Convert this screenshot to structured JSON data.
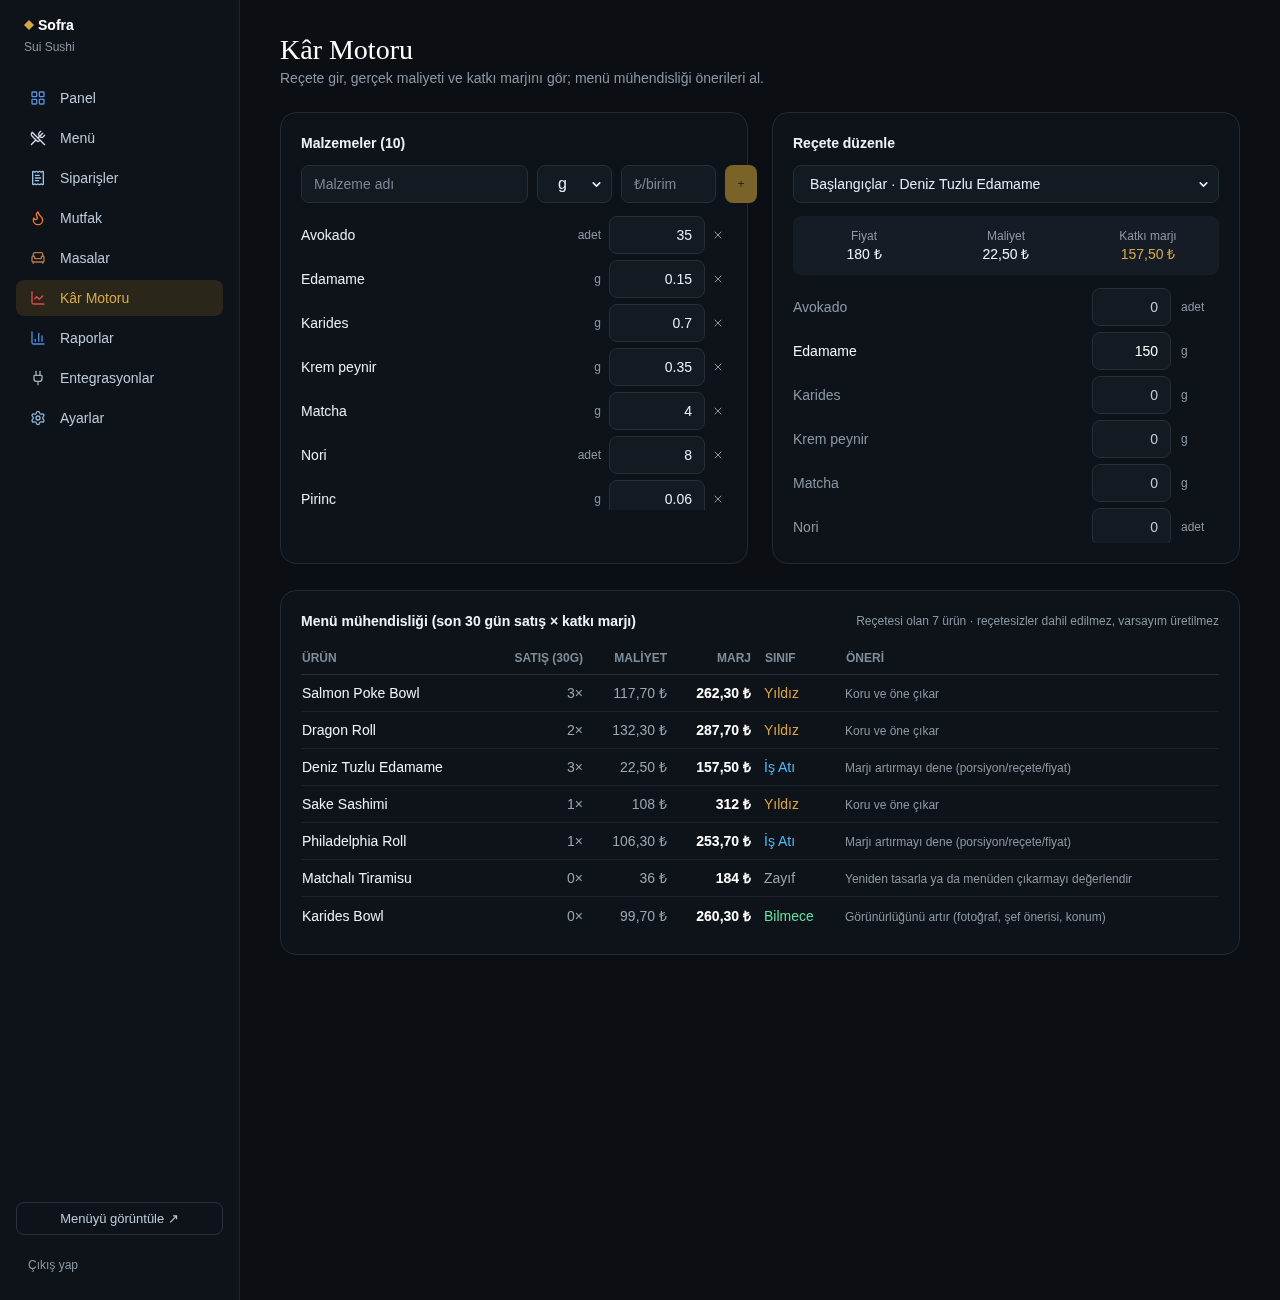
{
  "sidebar": {
    "brand": "Sofra",
    "subtitle": "Sui Sushi",
    "items": [
      {
        "label": "Panel",
        "selected": false
      },
      {
        "label": "Menü",
        "selected": false
      },
      {
        "label": "Siparişler",
        "selected": false
      },
      {
        "label": "Mutfak",
        "selected": false
      },
      {
        "label": "Masalar",
        "selected": false
      },
      {
        "label": "Kâr Motoru",
        "selected": true
      },
      {
        "label": "Raporlar",
        "selected": false
      },
      {
        "label": "Entegrasyonlar",
        "selected": false
      },
      {
        "label": "Ayarlar",
        "selected": false
      }
    ],
    "view_menu_button": "Menüyü görüntüle ↗",
    "logout_link": "Çıkış yap"
  },
  "page": {
    "title": "Kâr Motoru",
    "subtitle": "Reçete gir, gerçek maliyeti ve katkı marjını gör; menü mühendisliği önerileri al."
  },
  "ingredients": {
    "title": "Malzemeler (10)",
    "name_field": {
      "placeholder": "Malzeme adı"
    },
    "unit_select": {
      "value": "g"
    },
    "price_field": {
      "placeholder": "₺/birim"
    },
    "add_button": "+",
    "rows": [
      {
        "name": "Avokado",
        "unit": "adet",
        "price": "35"
      },
      {
        "name": "Edamame",
        "unit": "g",
        "price": "0.15"
      },
      {
        "name": "Karides",
        "unit": "g",
        "price": "0.7"
      },
      {
        "name": "Krem peynir",
        "unit": "g",
        "price": "0.35"
      },
      {
        "name": "Matcha",
        "unit": "g",
        "price": "4"
      },
      {
        "name": "Nori",
        "unit": "adet",
        "price": "8"
      },
      {
        "name": "Pirinc",
        "unit": "g",
        "price": "0.06"
      }
    ]
  },
  "recipe": {
    "title": "Reçete düzenle",
    "item_select": {
      "value": "Başlangıçlar · Deniz Tuzlu Edamame"
    },
    "summary": [
      {
        "label": "Fiyat",
        "value": "180 ₺",
        "highlighted": false
      },
      {
        "label": "Maliyet",
        "value": "22,50 ₺",
        "highlighted": false
      },
      {
        "label": "Katkı marjı",
        "value": "157,50 ₺",
        "highlighted": true
      }
    ],
    "rows": [
      {
        "name": "Avokado",
        "amount": "0",
        "unit": "adet",
        "included": false
      },
      {
        "name": "Edamame",
        "amount": "150",
        "unit": "g",
        "included": true
      },
      {
        "name": "Karides",
        "amount": "0",
        "unit": "g",
        "included": false
      },
      {
        "name": "Krem peynir",
        "amount": "0",
        "unit": "g",
        "included": false
      },
      {
        "name": "Matcha",
        "amount": "0",
        "unit": "g",
        "included": false
      },
      {
        "name": "Nori",
        "amount": "0",
        "unit": "adet",
        "included": false
      }
    ]
  },
  "menu_engineering": {
    "title": "Menü mühendisliği (son 30 gün satış × katkı marjı)",
    "note": "Reçetesi olan 7 ürün · reçetesizler dahil edilmez, varsayım üretilmez",
    "columns": [
      "ÜRÜN",
      "SATIŞ (30G)",
      "MALİYET",
      "MARJ",
      "SINIF",
      "ÖNERİ"
    ],
    "rows": [
      {
        "product": "Salmon Poke Bowl",
        "sales": "3×",
        "cost": "117,70 ₺",
        "margin": "262,30 ₺",
        "class": "Yıldız",
        "color": "#d9a441",
        "suggestion": "Koru ve öne çıkar"
      },
      {
        "product": "Dragon Roll",
        "sales": "2×",
        "cost": "132,30 ₺",
        "margin": "287,70 ₺",
        "class": "Yıldız",
        "color": "#d9a441",
        "suggestion": "Koru ve öne çıkar"
      },
      {
        "product": "Deniz Tuzlu Edamame",
        "sales": "3×",
        "cost": "22,50 ₺",
        "margin": "157,50 ₺",
        "class": "İş Atı",
        "color": "#4db8f5",
        "suggestion": "Marjı artırmayı dene (porsiyon/reçete/fiyat)"
      },
      {
        "product": "Sake Sashimi",
        "sales": "1×",
        "cost": "108 ₺",
        "margin": "312 ₺",
        "class": "Yıldız",
        "color": "#d9a441",
        "suggestion": "Koru ve öne çıkar"
      },
      {
        "product": "Philadelphia Roll",
        "sales": "1×",
        "cost": "106,30 ₺",
        "margin": "253,70 ₺",
        "class": "İş Atı",
        "color": "#4db8f5",
        "suggestion": "Marjı artırmayı dene (porsiyon/reçete/fiyat)"
      },
      {
        "product": "Matchalı Tiramisu",
        "sales": "0×",
        "cost": "36 ₺",
        "margin": "184 ₺",
        "class": "Zayıf",
        "color": "#9aa4ae",
        "suggestion": "Yeniden tasarla ya da menüden çıkarmayı değerlendir"
      },
      {
        "product": "Karides Bowl",
        "sales": "0×",
        "cost": "99,70 ₺",
        "margin": "260,30 ₺",
        "class": "Bilmece",
        "color": "#5fe3a0",
        "suggestion": "Görünürlüğünü artır (fotoğraf, şef önerisi, konum)"
      }
    ]
  }
}
